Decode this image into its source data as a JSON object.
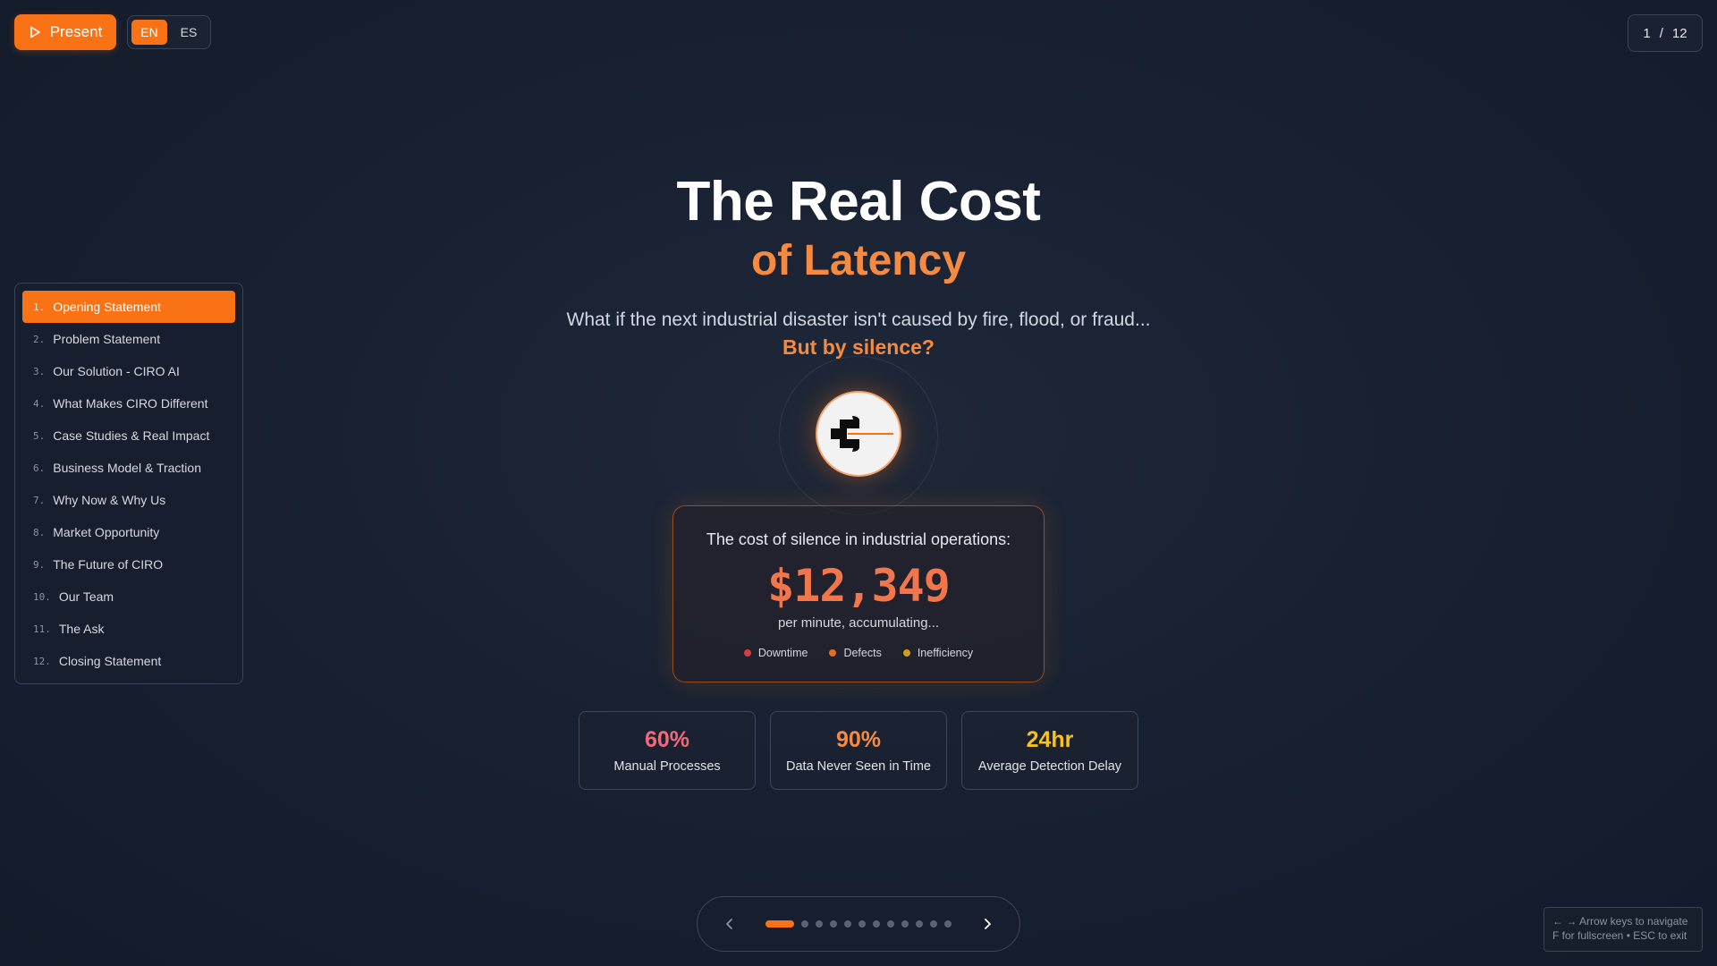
{
  "toolbar": {
    "present_label": "Present",
    "languages": [
      {
        "label": "EN",
        "active": true
      },
      {
        "label": "ES",
        "active": false
      }
    ]
  },
  "page_counter": {
    "current": "1",
    "separator": "/",
    "total": "12"
  },
  "sidebar": {
    "items": [
      {
        "number": "1.",
        "label": "Opening Statement",
        "active": true
      },
      {
        "number": "2.",
        "label": "Problem Statement",
        "active": false
      },
      {
        "number": "3.",
        "label": "Our Solution - CIRO AI",
        "active": false
      },
      {
        "number": "4.",
        "label": "What Makes CIRO Different",
        "active": false
      },
      {
        "number": "5.",
        "label": "Case Studies & Real Impact",
        "active": false
      },
      {
        "number": "6.",
        "label": "Business Model & Traction",
        "active": false
      },
      {
        "number": "7.",
        "label": "Why Now & Why Us",
        "active": false
      },
      {
        "number": "8.",
        "label": "Market Opportunity",
        "active": false
      },
      {
        "number": "9.",
        "label": "The Future of CIRO",
        "active": false
      },
      {
        "number": "10.",
        "label": "Our Team",
        "active": false
      },
      {
        "number": "11.",
        "label": "The Ask",
        "active": false
      },
      {
        "number": "12.",
        "label": "Closing Statement",
        "active": false
      }
    ]
  },
  "hero": {
    "title": "The Real Cost",
    "subtitle": "of Latency",
    "question": "What if the next industrial disaster isn't caused by fire, flood, or fraud...",
    "emphasis": "But by silence?"
  },
  "logo": {
    "icon": "ciro-logo-icon"
  },
  "cost_card": {
    "label": "The cost of silence in industrial operations:",
    "value": "$12,349",
    "rate": "per minute, accumulating...",
    "legend": [
      {
        "label": "Downtime",
        "color": "#dc3b3b"
      },
      {
        "label": "Defects",
        "color": "#ea6a1d"
      },
      {
        "label": "Inefficiency",
        "color": "#d49c17"
      }
    ]
  },
  "stats": [
    {
      "value": "60%",
      "label": "Manual Processes",
      "color": "#f06a7a"
    },
    {
      "value": "90%",
      "label": "Data Never Seen in Time",
      "color": "#f58a40"
    },
    {
      "value": "24hr",
      "label": "Average Detection Delay",
      "color": "#f7c21a"
    }
  ],
  "pagination": {
    "total_slides": 12,
    "active_index": 0
  },
  "keyboard_hint": {
    "line1": "← → Arrow keys to navigate",
    "line2": "F for fullscreen • ESC to exit"
  },
  "colors": {
    "accent": "#f97316",
    "background": "#182132"
  }
}
